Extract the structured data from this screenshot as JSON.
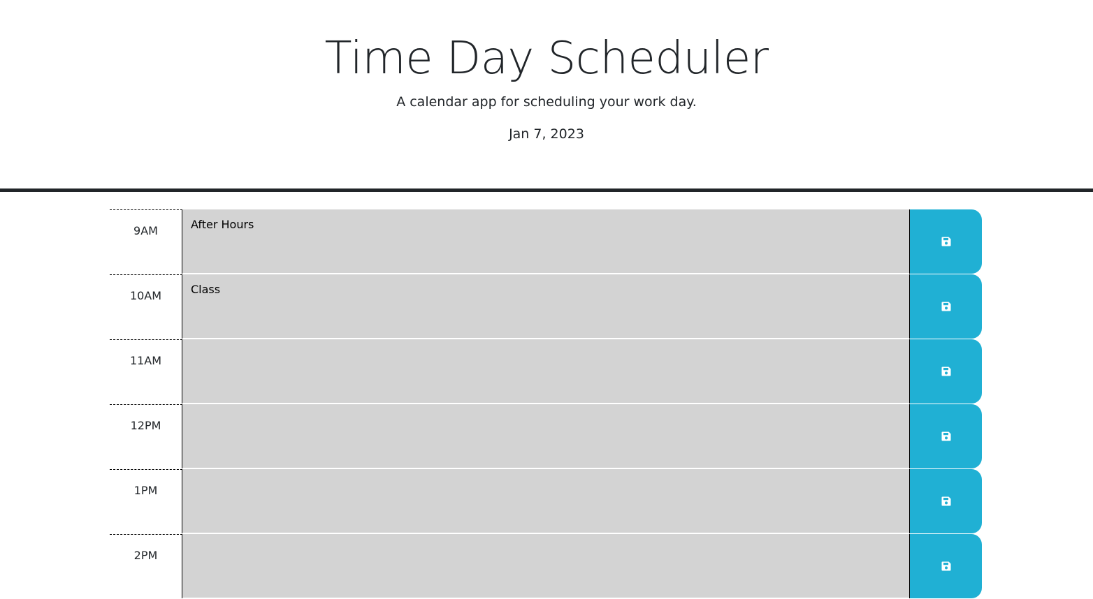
{
  "header": {
    "title": "Time Day Scheduler",
    "subtitle": "A calendar app for scheduling your work day.",
    "current_date": "Jan 7, 2023"
  },
  "time_blocks": [
    {
      "hour": "9AM",
      "description": "After Hours"
    },
    {
      "hour": "10AM",
      "description": "Class"
    },
    {
      "hour": "11AM",
      "description": ""
    },
    {
      "hour": "12PM",
      "description": ""
    },
    {
      "hour": "1PM",
      "description": ""
    },
    {
      "hour": "2PM",
      "description": ""
    }
  ],
  "save_icon": "floppy-disk-icon",
  "colors": {
    "save_button": "#20b0d4",
    "textarea_past": "#d3d3d3",
    "divider": "#212529"
  }
}
